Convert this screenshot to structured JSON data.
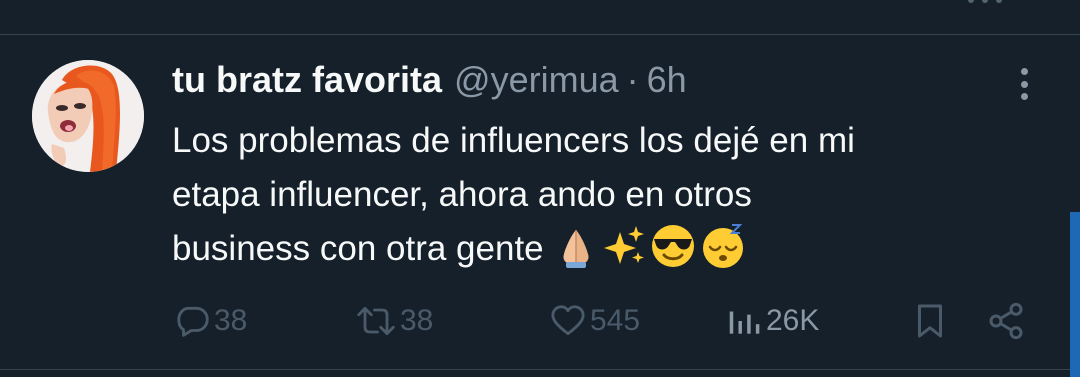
{
  "tweet": {
    "author": {
      "display_name": "tu bratz favorita",
      "handle": "@yerimua",
      "separator": "·",
      "time": "6h"
    },
    "text_lines": [
      "Los problemas de influencers los dejé en mi",
      "etapa influencer, ahora ando en otros",
      "business con otra gente"
    ],
    "emojis": [
      "folded-hands",
      "sparkles",
      "sunglasses-face",
      "sleeping-face"
    ],
    "actions": {
      "replies": "38",
      "reposts": "38",
      "likes": "545",
      "views": "26K"
    }
  },
  "colors": {
    "background": "#15202b",
    "text_primary": "#f7f9f9",
    "text_secondary": "#8b98a5",
    "action_muted": "#4b5a68",
    "accent": "#1d69b5"
  }
}
